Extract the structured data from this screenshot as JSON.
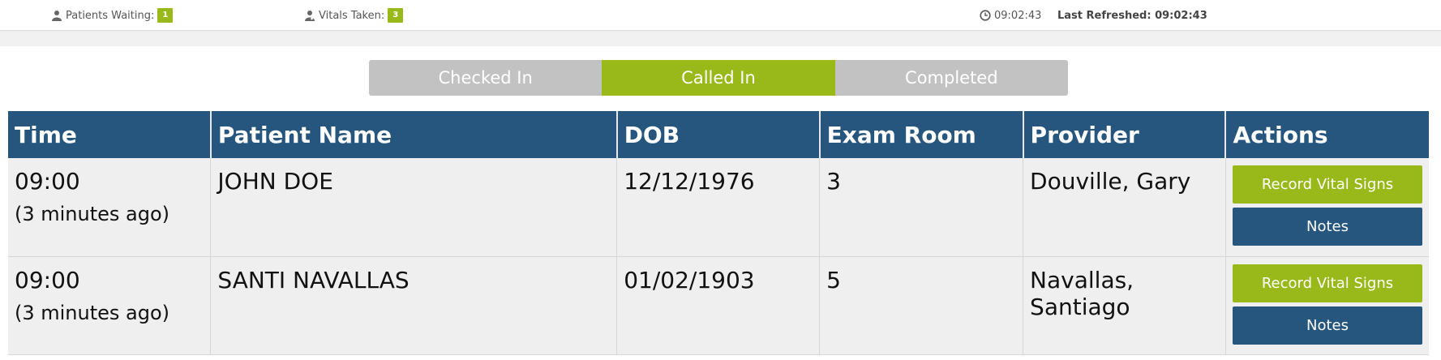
{
  "topbar": {
    "patients_waiting_label": "Patients Waiting:",
    "patients_waiting_count": "1",
    "vitals_taken_label": "Vitals Taken:",
    "vitals_taken_count": "3",
    "clock_time": "09:02:43",
    "last_refreshed": "Last Refreshed: 09:02:43",
    "icons": [
      "person-icon",
      "doctor-icon",
      "clock-icon"
    ]
  },
  "tabs": [
    {
      "label": "Checked In",
      "active": false
    },
    {
      "label": "Called In",
      "active": true
    },
    {
      "label": "Completed",
      "active": false
    }
  ],
  "table": {
    "headers": [
      "Time",
      "Patient Name",
      "DOB",
      "Exam Room",
      "Provider",
      "Actions"
    ],
    "rows": [
      {
        "time": "09:00",
        "ago": "(3 minutes ago)",
        "name": "JOHN DOE",
        "dob": "12/12/1976",
        "room": "3",
        "provider": "Douville, Gary",
        "vitals_btn": "Record Vital Signs",
        "notes_btn": "Notes"
      },
      {
        "time": "09:00",
        "ago": "(3 minutes ago)",
        "name": "SANTI NAVALLAS",
        "dob": "01/02/1903",
        "room": "5",
        "provider": "Navallas, Santiago",
        "vitals_btn": "Record Vital Signs",
        "notes_btn": "Notes"
      }
    ]
  },
  "colors": {
    "accent_green": "#99b91a",
    "header_blue": "#26567e",
    "tab_gray": "#c2c2c2"
  }
}
